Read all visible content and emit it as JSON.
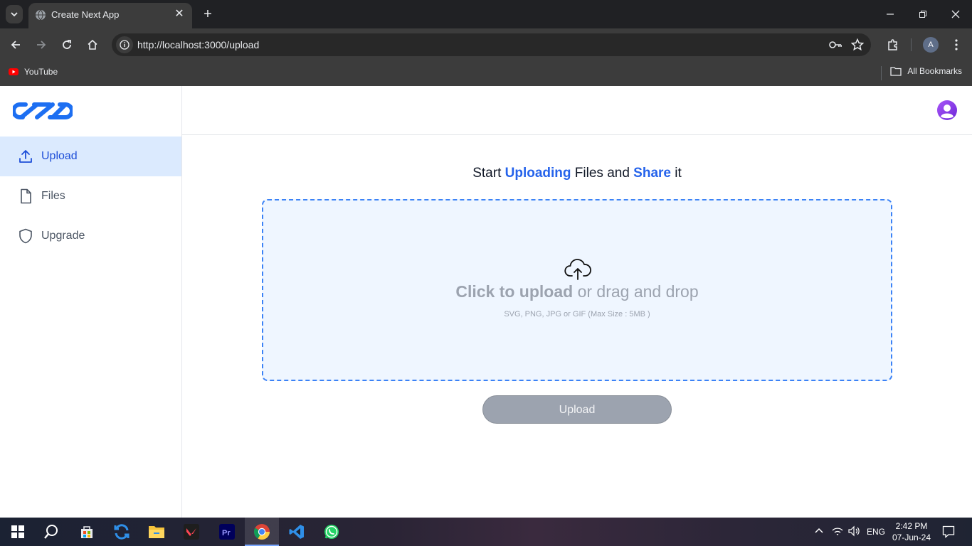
{
  "browser": {
    "tab_title": "Create Next App",
    "url": "http://localhost:3000/upload",
    "profile_initial": "A",
    "bookmarks": [
      {
        "label": "YouTube"
      }
    ],
    "all_bookmarks_label": "All Bookmarks"
  },
  "sidebar": {
    "items": [
      {
        "label": "Upload",
        "icon": "upload-icon",
        "active": true
      },
      {
        "label": "Files",
        "icon": "file-icon",
        "active": false
      },
      {
        "label": "Upgrade",
        "icon": "shield-icon",
        "active": false
      }
    ]
  },
  "main": {
    "heading": {
      "part1": "Start ",
      "highlight1": "Uploading",
      "part2": " Files and ",
      "highlight2": "Share",
      "part3": " it"
    },
    "dropzone": {
      "click_text": "Click to upload",
      "rest_text": " or drag and drop",
      "hint": "SVG, PNG, JPG or GIF (Max Size : 5MB )"
    },
    "upload_button": "Upload"
  },
  "taskbar": {
    "language": "ENG",
    "time": "2:42 PM",
    "date": "07-Jun-24"
  },
  "colors": {
    "accent": "#2563eb",
    "active_nav_bg": "#dbeafe",
    "dropzone_bg": "#eff6ff",
    "disabled_button": "#9ca3af"
  }
}
